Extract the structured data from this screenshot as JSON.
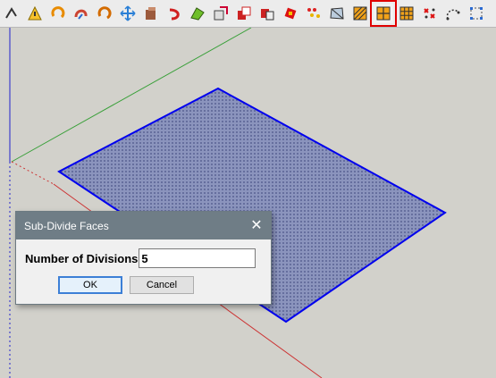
{
  "toolbar": {
    "icons": [
      {
        "name": "circle-tool-icon"
      },
      {
        "name": "warning-triangle-icon"
      },
      {
        "name": "rotate-arc-icon"
      },
      {
        "name": "follow-me-icon"
      },
      {
        "name": "orbit-icon"
      },
      {
        "name": "move-cross-icon"
      },
      {
        "name": "push-pull-box-icon"
      },
      {
        "name": "undo-curve-icon"
      },
      {
        "name": "extrude-green-icon"
      },
      {
        "name": "component-edit-icon"
      },
      {
        "name": "solid-tools-red-icon"
      },
      {
        "name": "solid-subtract-icon"
      },
      {
        "name": "red-square-icon"
      },
      {
        "name": "vertex-pattern-icon"
      },
      {
        "name": "texture-plane-icon"
      },
      {
        "name": "divide-diagonal-icon"
      },
      {
        "name": "subdivide-faces-icon"
      },
      {
        "name": "grid-faces-icon"
      },
      {
        "name": "delete-vertices-icon"
      },
      {
        "name": "arc-points-icon"
      },
      {
        "name": "vertex-grid-icon"
      }
    ],
    "active_tool": "subdivide-faces-icon",
    "highlight_color": "#e00000"
  },
  "scene": {
    "face_fill": "#8892b8",
    "face_edge_color": "#0000ee",
    "axis_red": "#cc3333",
    "axis_green": "#3aa03a",
    "axis_blue": "#2222cc",
    "background": "#d2d1cb"
  },
  "dialog": {
    "title": "Sub-Divide Faces",
    "close_glyph": "✕",
    "field_label": "Number of Divisions",
    "field_value": "5",
    "ok_label": "OK",
    "cancel_label": "Cancel"
  }
}
